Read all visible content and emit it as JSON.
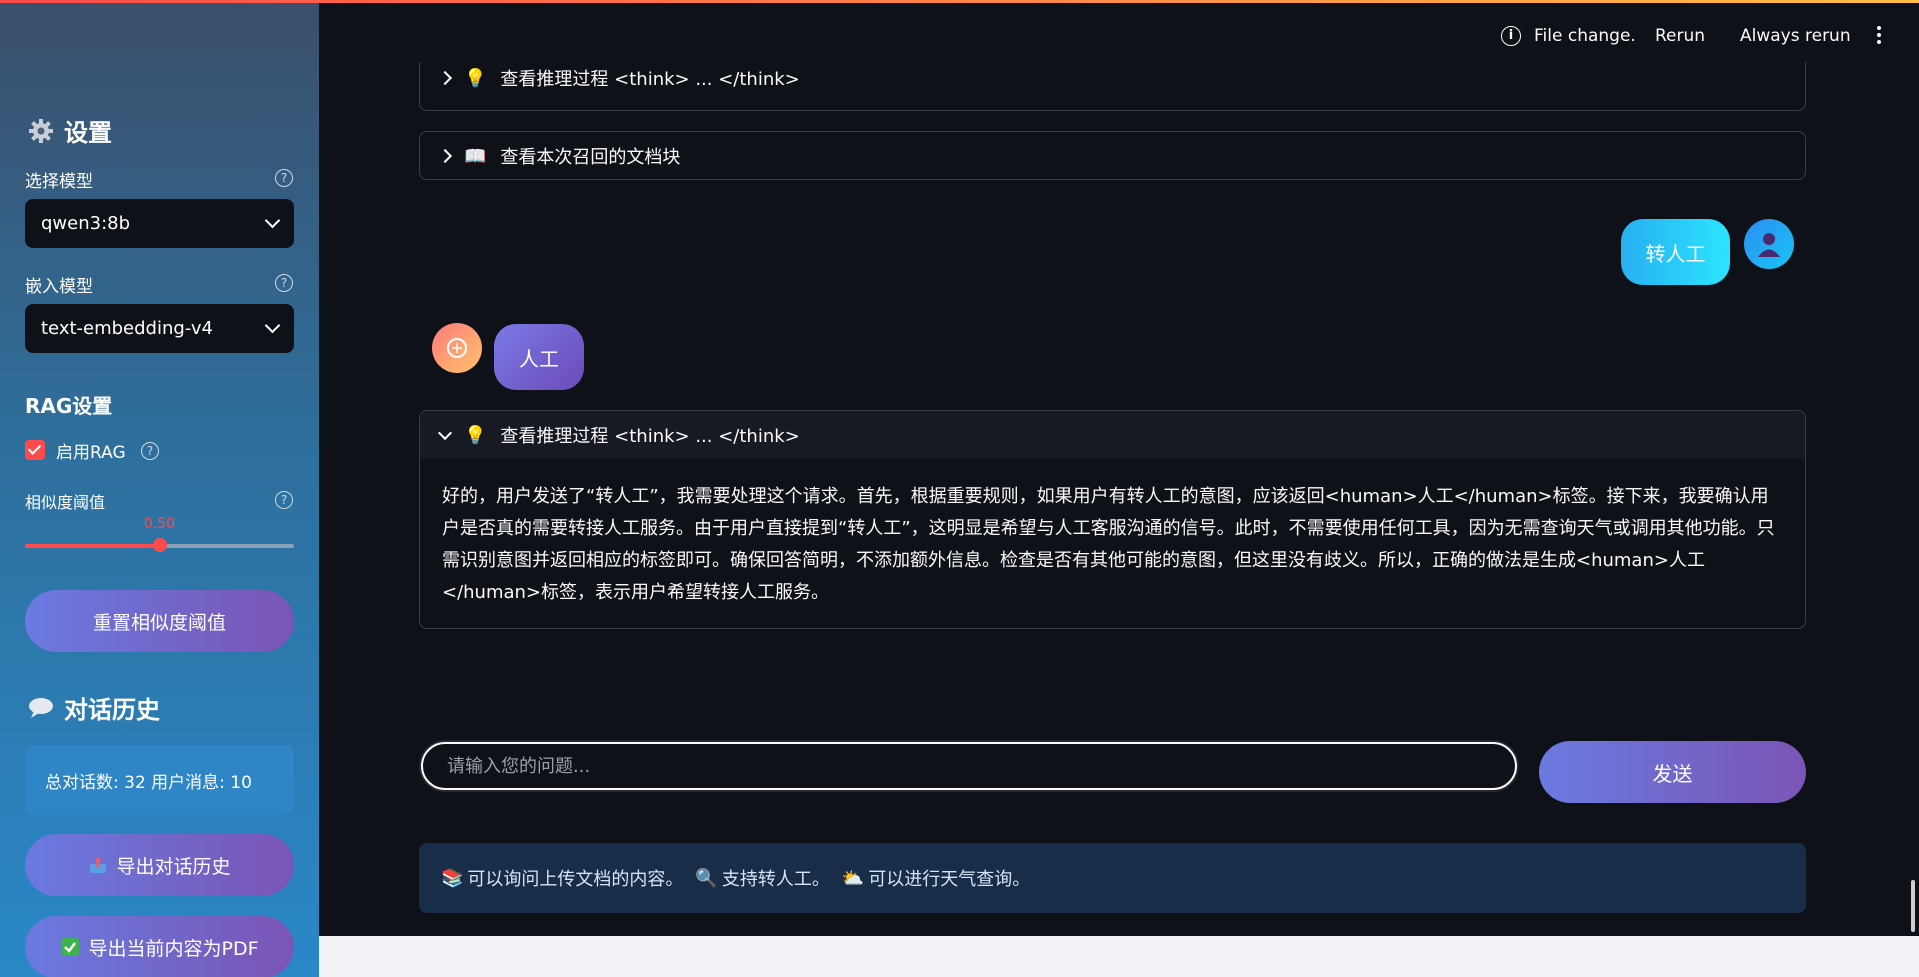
{
  "header": {
    "status_text": "File change.",
    "rerun_label": "Rerun",
    "always_rerun_label": "Always rerun"
  },
  "sidebar": {
    "settings_title": "设置",
    "model_label": "选择模型",
    "model_value": "qwen3:8b",
    "embed_label": "嵌入模型",
    "embed_value": "text-embedding-v4",
    "rag_title": "RAG设置",
    "rag_checkbox_label": "启用RAG",
    "rag_enabled": true,
    "threshold_label": "相似度阈值",
    "threshold_value": "0.50",
    "threshold_fraction": 0.5,
    "reset_button": "重置相似度阈值",
    "history_title": "对话历史",
    "history_stats": "总对话数: 32 用户消息: 10",
    "export_history_button": "导出对话历史",
    "export_pdf_button": "导出当前内容为PDF"
  },
  "main": {
    "expander_think_1": "查看推理过程 <think> ... </think>",
    "expander_docs": "查看本次召回的文档块",
    "user_message": "转人工",
    "bot_message": "人工",
    "expander_think_2": "查看推理过程 <think> ... </think>",
    "think_content": "好的，用户发送了“转人工”，我需要处理这个请求。首先，根据重要规则，如果用户有转人工的意图，应该返回<human>人工</human>标签。接下来，我要确认用户是否真的需要转接人工服务。由于用户直接提到“转人工”，这明显是希望与人工客服沟通的信号。此时，不需要使用任何工具，因为无需查询天气或调用其他功能。只需识别意图并返回相应的标签即可。确保回答简明，不添加额外信息。检查是否有其他可能的意图，但这里没有歧义。所以，正确的做法是生成<human>人工</human>标签，表示用户希望转接人工服务。",
    "input_placeholder": "请输入您的问题...",
    "send_button": "发送",
    "tip_docs": "可以询问上传文档的内容。",
    "tip_human": "支持转人工。",
    "tip_weather": "可以进行天气查询。"
  },
  "colors": {
    "accent": "#ff4b4b",
    "background": "#0e1117",
    "button_gradient_start": "#6a7ae0",
    "button_gradient_end": "#7a55b5"
  },
  "icons": {
    "settings": "gear-icon",
    "history": "speech-bubble-icon",
    "think": "lightbulb-icon",
    "docs": "open-book-icon",
    "export_history": "outbox-tray-icon",
    "export_pdf": "check-mark-icon",
    "tip_docs": "books-icon",
    "tip_human": "magnifier-icon",
    "tip_weather": "sun-cloud-icon"
  }
}
